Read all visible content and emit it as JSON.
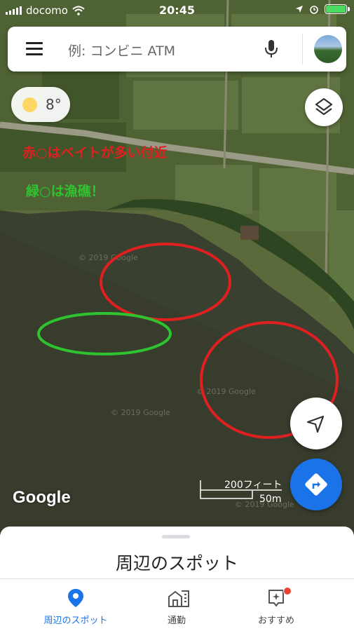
{
  "status_bar": {
    "carrier": "docomo",
    "time": "20:45"
  },
  "search": {
    "placeholder": "例: コンビニ ATM"
  },
  "weather": {
    "temperature": "8°"
  },
  "map": {
    "annotations": {
      "red_note": "赤○はベイトが多い付近",
      "green_note": "緑○は漁礁！"
    },
    "watermark": "© 2019 Google",
    "logo": "Google",
    "scale": {
      "feet": "200フィート",
      "meters": "50m"
    }
  },
  "sheet": {
    "title": "周辺のスポット"
  },
  "tabs": [
    {
      "label": "周辺のスポット",
      "active": true,
      "icon": "place-pin-icon"
    },
    {
      "label": "通勤",
      "active": false,
      "icon": "commute-icon"
    },
    {
      "label": "おすすめ",
      "active": false,
      "icon": "for-you-icon"
    }
  ],
  "colors": {
    "accent": "#1a73e8",
    "red_circle": "#e02020",
    "green_circle": "#2fc42f",
    "badge": "#ea4335"
  }
}
